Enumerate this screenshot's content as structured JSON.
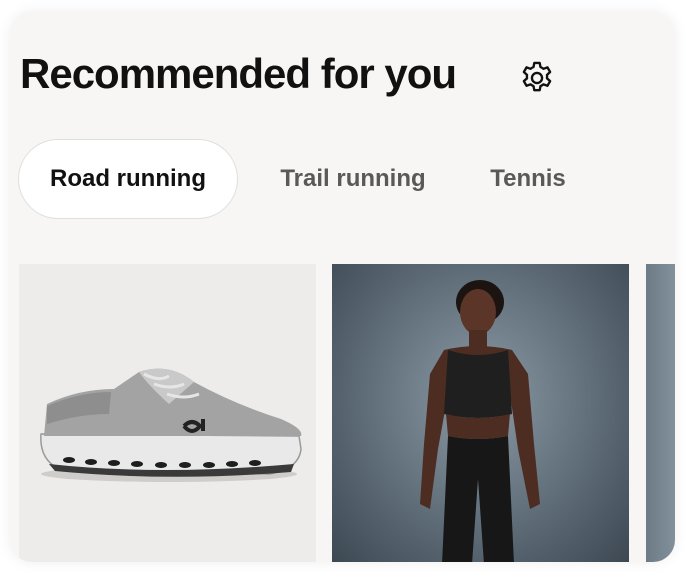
{
  "header": {
    "title": "Recommended for you",
    "settings_icon": "gear-icon"
  },
  "tabs": [
    {
      "label": "Road running",
      "active": true
    },
    {
      "label": "Trail running",
      "active": false
    },
    {
      "label": "Tennis",
      "active": false
    }
  ],
  "products": [
    {
      "image": "grey running shoe"
    },
    {
      "image": "woman in black crop top and leggings"
    },
    {
      "image": "partially visible product"
    }
  ],
  "colors": {
    "card_background": "#f8f6f4",
    "active_tab_background": "#ffffff",
    "title_text": "#111111",
    "inactive_tab_text": "#595959"
  }
}
